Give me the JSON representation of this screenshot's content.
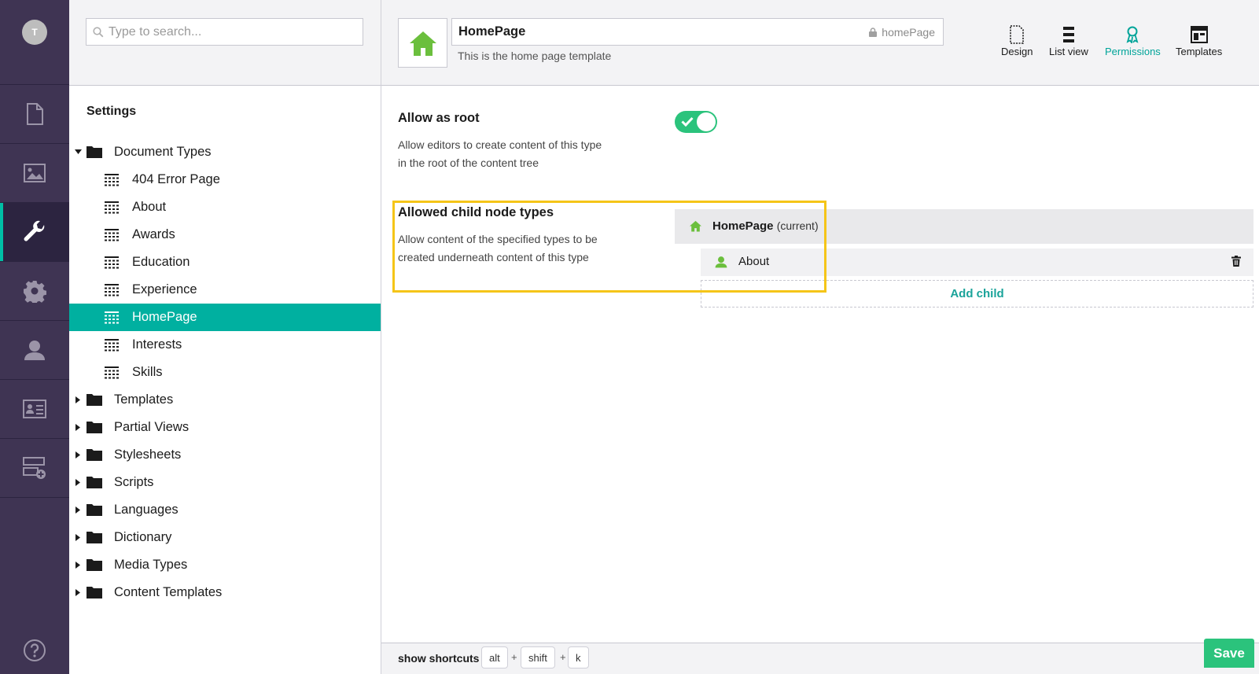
{
  "user": {
    "avatar_initial": "T"
  },
  "rail": {
    "sections": [
      {
        "icon": "document-icon",
        "active": false
      },
      {
        "icon": "image-icon",
        "active": false
      },
      {
        "icon": "wrench-icon",
        "active": true
      },
      {
        "icon": "gear-icon",
        "active": false
      },
      {
        "icon": "user-icon",
        "active": false
      },
      {
        "icon": "id-card-icon",
        "active": false
      },
      {
        "icon": "form-add-icon",
        "active": false
      }
    ],
    "help_icon": "help-icon"
  },
  "search": {
    "placeholder": "Type to search..."
  },
  "tree": {
    "heading": "Settings",
    "document_types_label": "Document Types",
    "doc_types": [
      "404 Error Page",
      "About",
      "Awards",
      "Education",
      "Experience",
      "HomePage",
      "Interests",
      "Skills"
    ],
    "selected": "HomePage",
    "folders": [
      "Templates",
      "Partial Views",
      "Stylesheets",
      "Scripts",
      "Languages",
      "Dictionary",
      "Media Types",
      "Content Templates"
    ]
  },
  "header": {
    "name": "HomePage",
    "alias": "homePage",
    "description": "This is the home page template",
    "apps": [
      {
        "label": "Design",
        "icon": "document-outline-icon",
        "active": false
      },
      {
        "label": "List view",
        "icon": "list-view-icon",
        "active": false
      },
      {
        "label": "Permissions",
        "icon": "award-icon",
        "active": true
      },
      {
        "label": "Templates",
        "icon": "layout-icon",
        "active": false
      }
    ]
  },
  "permissions": {
    "allow_root": {
      "title": "Allow as root",
      "desc_line1": "Allow editors to create content of this type",
      "desc_line2": "in the root of the content tree",
      "enabled": true
    },
    "allowed_children": {
      "title": "Allowed child node types",
      "desc_line1": "Allow content of the specified types to be",
      "desc_line2": "created underneath content of this type",
      "current_name": "HomePage",
      "current_suffix": "(current)",
      "child_name": "About",
      "add_child_label": "Add child"
    }
  },
  "footer": {
    "shortcuts_label": "show shortcuts",
    "keys": [
      "alt",
      "shift",
      "k"
    ],
    "plus": "+",
    "save_label": "Save"
  },
  "colors": {
    "accent": "#00b0a0",
    "rail": "#3f3453",
    "success": "#2bc37c",
    "highlight": "#f5c518"
  }
}
